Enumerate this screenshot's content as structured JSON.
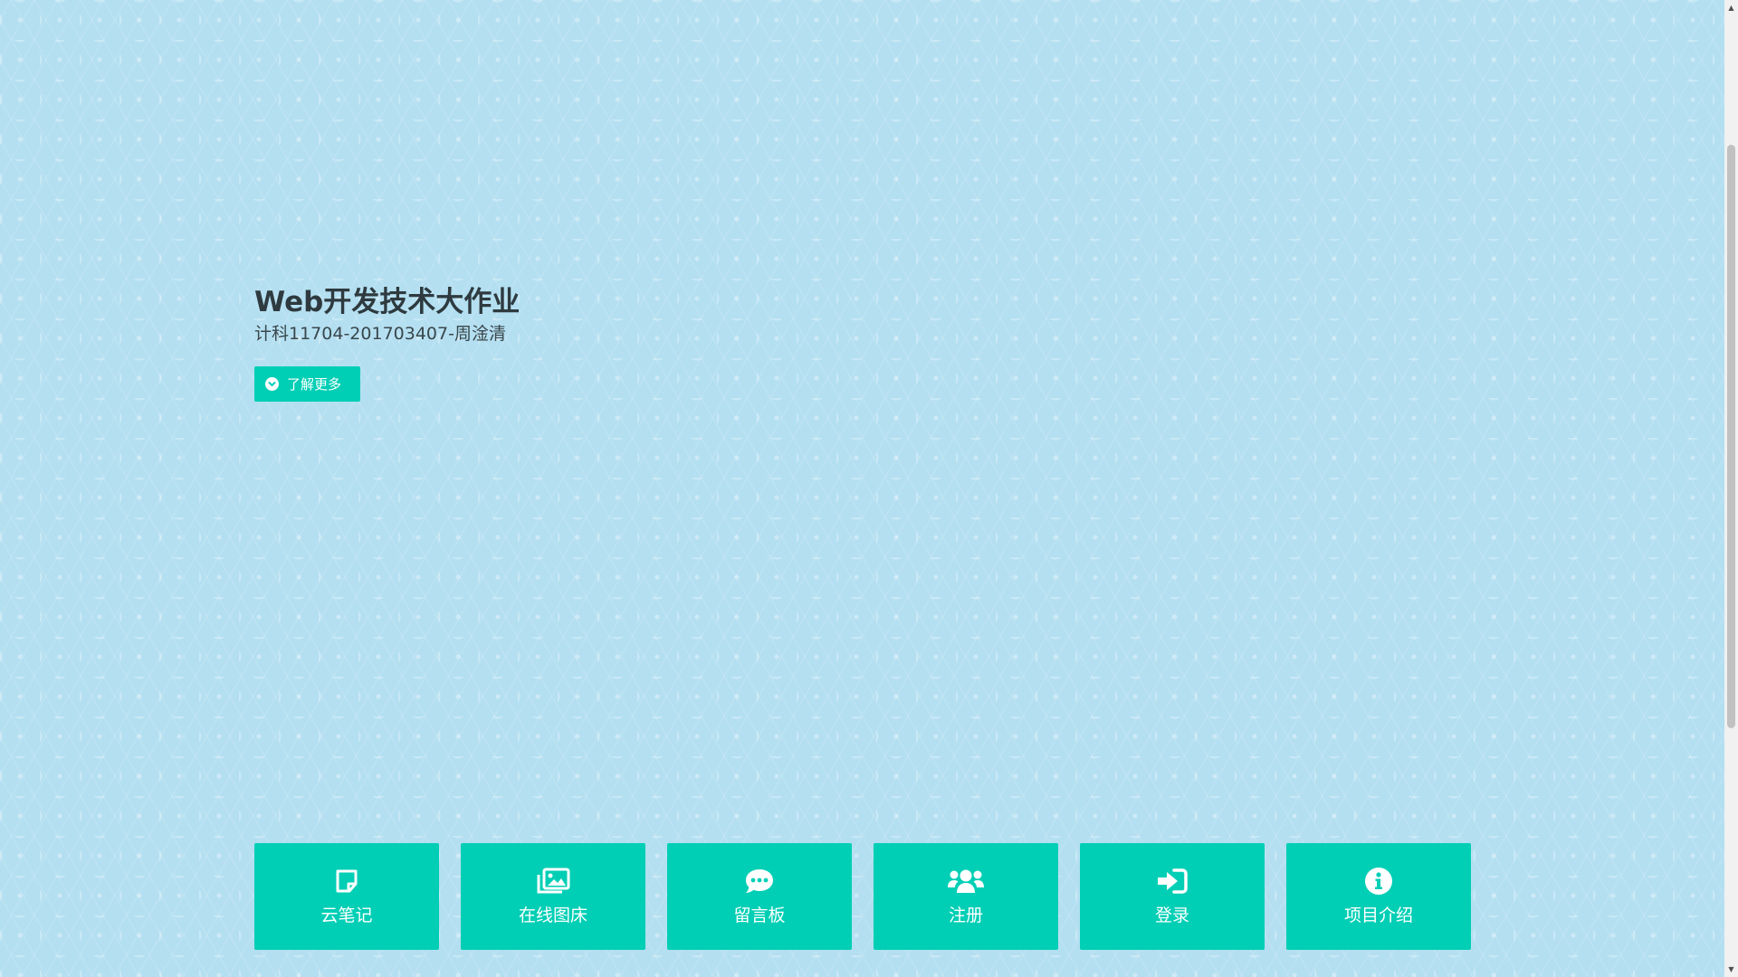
{
  "hero": {
    "title": "Web开发技术大作业",
    "subtitle": "计科11704-201703407-周淦清",
    "learn_more_label": "了解更多"
  },
  "tiles": [
    {
      "label": "云笔记",
      "icon": "sticky-note-icon"
    },
    {
      "label": "在线图床",
      "icon": "images-icon"
    },
    {
      "label": "留言板",
      "icon": "comment-dots-icon"
    },
    {
      "label": "注册",
      "icon": "users-icon"
    },
    {
      "label": "登录",
      "icon": "sign-in-icon"
    },
    {
      "label": "项目介绍",
      "icon": "info-circle-icon"
    }
  ],
  "colors": {
    "accent": "#00cfb5",
    "background": "#b3dff1",
    "title_text": "#2e3a3f"
  }
}
